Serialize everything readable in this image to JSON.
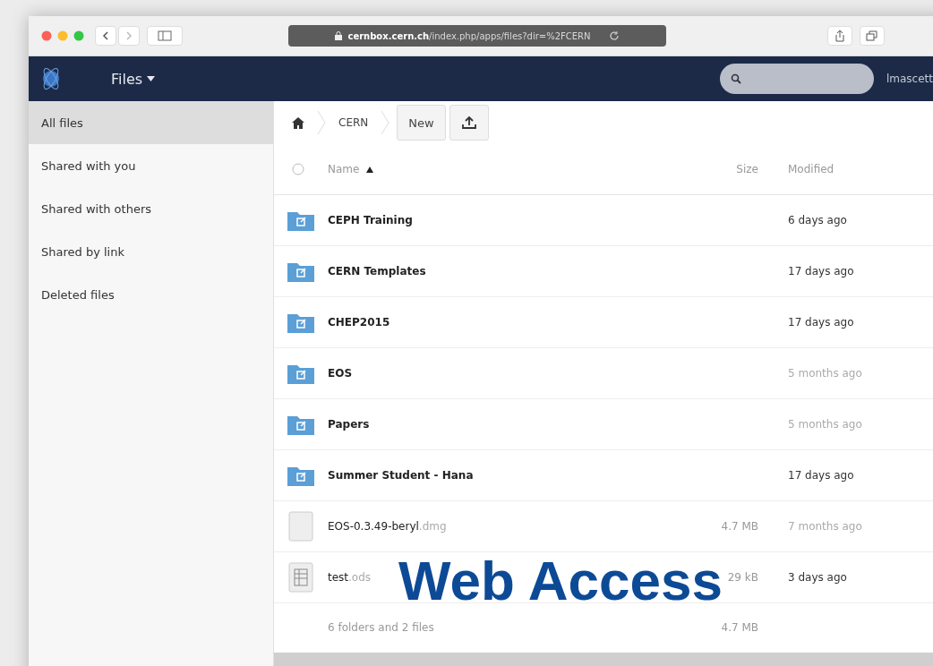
{
  "browser": {
    "address": "**cernbox.cern.ch**/index.php/apps/files?dir=%2FCERN"
  },
  "navbar": {
    "app_menu": "Files",
    "user": "lmascett"
  },
  "sidebar": {
    "items": [
      {
        "label": "All files",
        "selected": true
      },
      {
        "label": "Shared with you",
        "selected": false
      },
      {
        "label": "Shared with others",
        "selected": false
      },
      {
        "label": "Shared by link",
        "selected": false
      },
      {
        "label": "Deleted files",
        "selected": false
      }
    ]
  },
  "breadcrumb": [
    "CERN"
  ],
  "toolbar": {
    "new_button": "New"
  },
  "table": {
    "select_all": {
      "checked": false
    },
    "columns": [
      {
        "label": "Name",
        "sorted": true
      },
      {
        "label": "Size",
        "sorted": false
      },
      {
        "label": "Modified",
        "sorted": false
      }
    ],
    "rows": [
      {
        "kind": "folder",
        "name": "CEPH Training",
        "modified": "6 days ago",
        "recent": true
      },
      {
        "kind": "folder",
        "name": "CERN Templates",
        "modified": "17 days ago",
        "recent": true
      },
      {
        "kind": "folder",
        "name": "CHEP2015",
        "modified": "17 days ago",
        "recent": true
      },
      {
        "kind": "folder",
        "name": "EOS",
        "modified": "5 months ago",
        "recent": false
      },
      {
        "kind": "folder",
        "name": "Papers",
        "modified": "5 months ago",
        "recent": false
      },
      {
        "kind": "folder",
        "name": "Summer Student - Hana",
        "modified": "17 days ago",
        "recent": true
      },
      {
        "kind": "file",
        "name": "EOS-0.3.49-beryl",
        "extension": ".dmg",
        "size": "4.7 MB",
        "modified": "7 months ago",
        "recent": false
      },
      {
        "kind": "spreadsheet",
        "name": "test",
        "extension": ".ods",
        "size": "29 kB",
        "modified": "3 days ago",
        "recent": true
      }
    ],
    "summary": {
      "count": "6 folders and 2 files",
      "size": "4.7 MB"
    }
  },
  "overlay_caption": "Web Access"
}
